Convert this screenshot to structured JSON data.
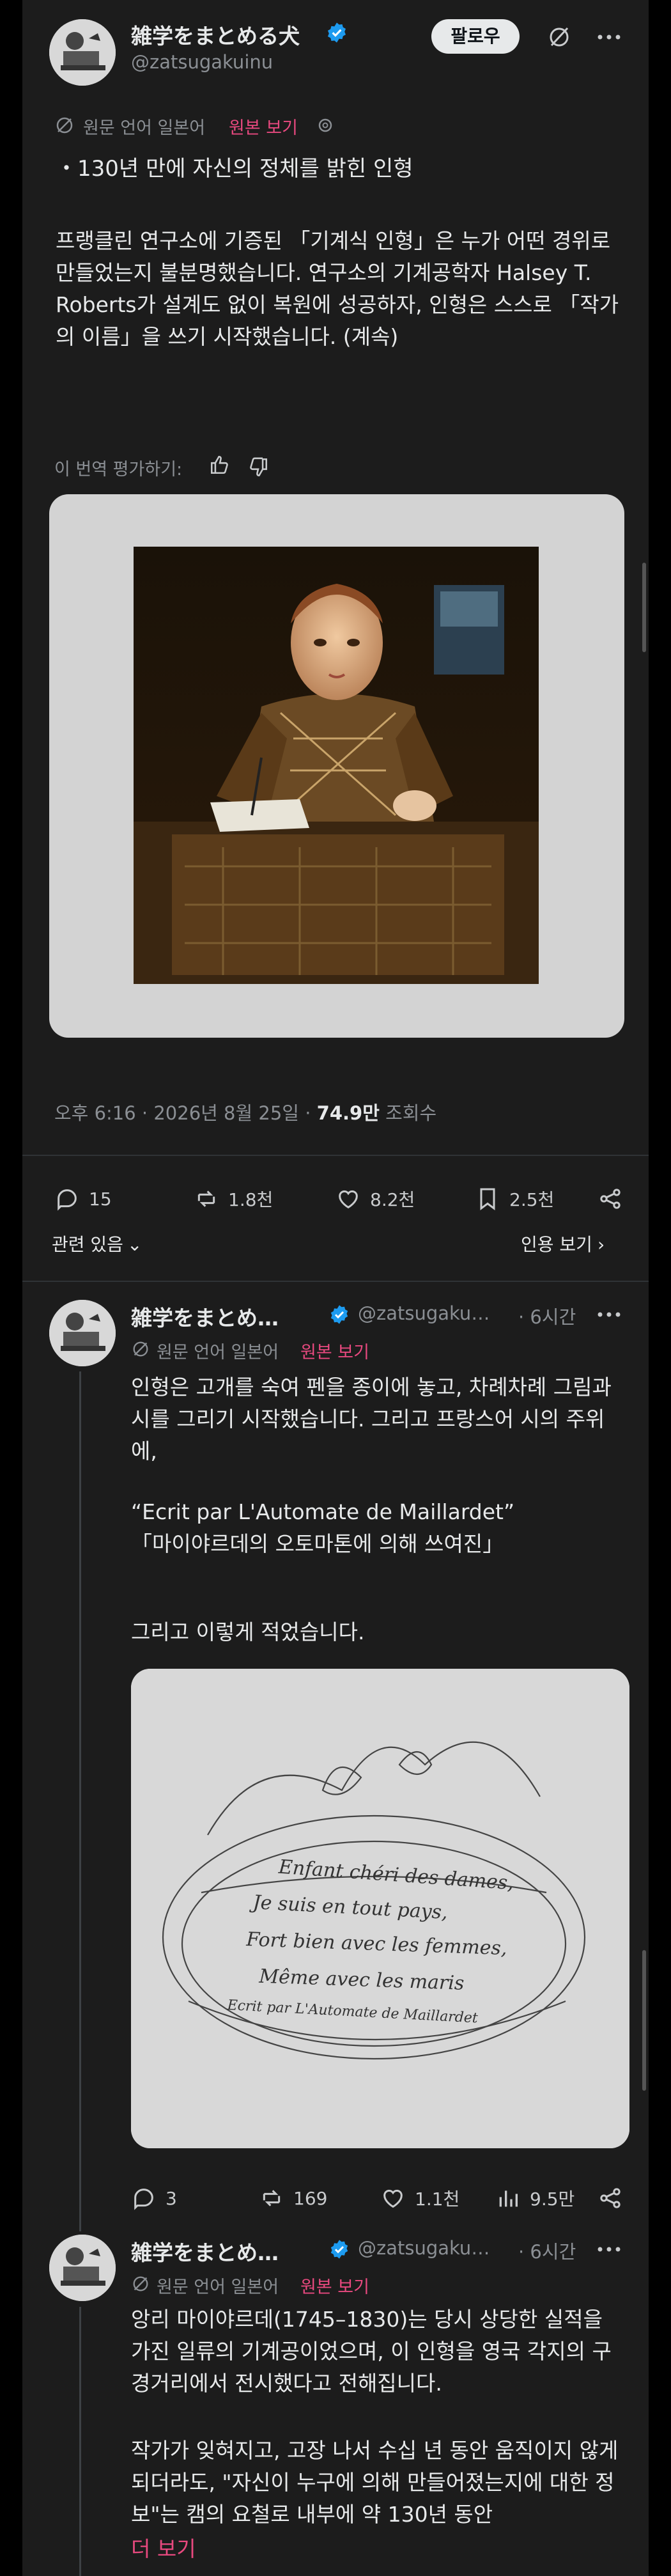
{
  "main_post": {
    "author_name": "雑学をまとめる犬",
    "handle": "@zatsugakuinu",
    "follow_label": "팔로우",
    "translation_note": "원문 언어 일본어",
    "show_original": "원본 보기",
    "headline": "・130년 만에 자신의 정체를 밝힌 인형",
    "body": "프랭클린 연구소에 기증된 「기계식 인형」은 누가 어떤 경위로 만들었는지 불분명했습니다. 연구소의 기계공학자 Halsey T. Roberts가 설계도 없이 복원에 성공하자, 인형은 스스로 「작가의 이름」을 쓰기 시작했습니다. (계속)",
    "rate_translation": "이 번역 평가하기:",
    "timestamp": "오후 6:16 · 2026년 8월 25일 · ",
    "views_count": "74.9만",
    "views_label": " 조회수",
    "replies": "15",
    "reposts": "1.8천",
    "likes": "8.2천",
    "bookmarks": "2.5천",
    "related": "관련 있음",
    "view_quotes": "인용 보기"
  },
  "replies": [
    {
      "author_name": "雑学をまとめ…",
      "handle": "@zatsugaku…",
      "time": "· 6시간",
      "translation_note": "원문 언어 일본어",
      "show_original": "원본 보기",
      "body_lines": [
        "인형은 고개를 숙여 펜을 종이에 놓고, 차례차례 그림과 시를 그리기 시작했습니다. 그리고 프랑스어 시의 주위에,",
        "“Ecrit par L'Automate de Maillardet”\n「마이야르데의 오토마톤에 의해 쓰여진」",
        "그리고 이렇게 적었습니다."
      ],
      "image_text": [
        "Enfant chéri des dames,",
        "Je suis en tout pays,",
        "Fort bien avec les femmes,",
        "Même avec les maris",
        "Ecrit par L'Automate de Maillardet"
      ],
      "replies": "3",
      "reposts": "169",
      "likes": "1.1천",
      "views": "9.5만"
    },
    {
      "author_name": "雑学をまとめ…",
      "handle": "@zatsugaku…",
      "time": "· 6시간",
      "translation_note": "원문 언어 일본어",
      "show_original": "원본 보기",
      "body_lines": [
        "앙리 마이야르데(1745–1830)는 당시 상당한 실적을 가진 일류의 기계공이었으며, 이 인형을 영국 각지의 구경거리에서 전시했다고 전해집니다.",
        "작가가 잊혀지고, 고장 나서 수십 년 동안 움직이지 않게 되더라도, \"자신이 누구에 의해 만들어졌는지에 대한 정보\"는 캠의 요철로 내부에 약 130년 동안"
      ],
      "more": "더 보기"
    }
  ],
  "colors": {
    "background": "#1c1c1c",
    "accent": "#e8497f",
    "verified": "#1d9bf0"
  }
}
